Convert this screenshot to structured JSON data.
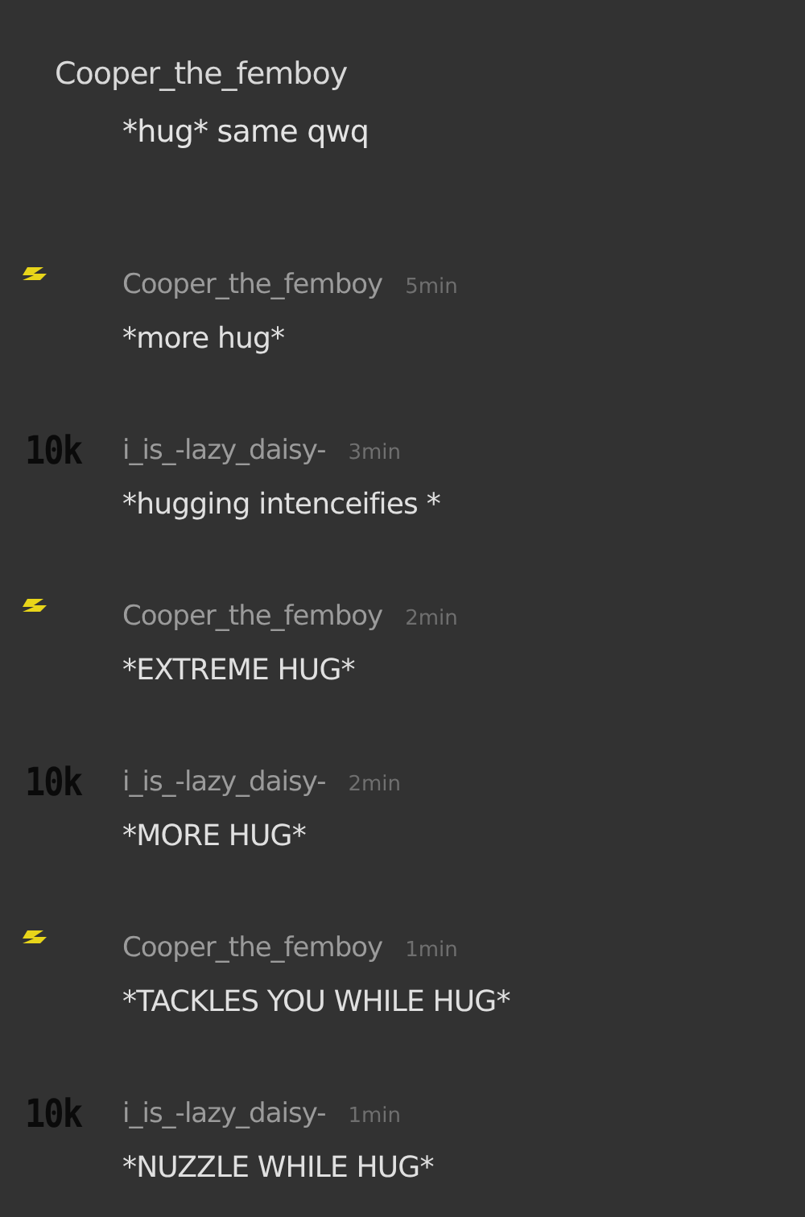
{
  "parent_comment": {
    "username": "Cooper_the_femboy",
    "message": "*hug* same qwq"
  },
  "replies": [
    {
      "badge": {
        "kind": "bolt"
      },
      "username": "Cooper_the_femboy",
      "time": "5min",
      "message": "*more hug*"
    },
    {
      "badge": {
        "kind": "points",
        "text": "10k"
      },
      "username": "i_is_-lazy_daisy-",
      "time": "3min",
      "message": "*hugging intenceifies *"
    },
    {
      "badge": {
        "kind": "bolt"
      },
      "username": "Cooper_the_femboy",
      "time": "2min",
      "message": "*EXTREME HUG*"
    },
    {
      "badge": {
        "kind": "points",
        "text": "10k"
      },
      "username": "i_is_-lazy_daisy-",
      "time": "2min",
      "message": "*MORE HUG*"
    },
    {
      "badge": {
        "kind": "bolt"
      },
      "username": "Cooper_the_femboy",
      "time": "1min",
      "message": "*TACKLES YOU WHILE HUG*"
    },
    {
      "badge": {
        "kind": "points",
        "text": "10k"
      },
      "username": "i_is_-lazy_daisy-",
      "time": "1min",
      "message": "*NUZZLE WHILE HUG*"
    }
  ]
}
